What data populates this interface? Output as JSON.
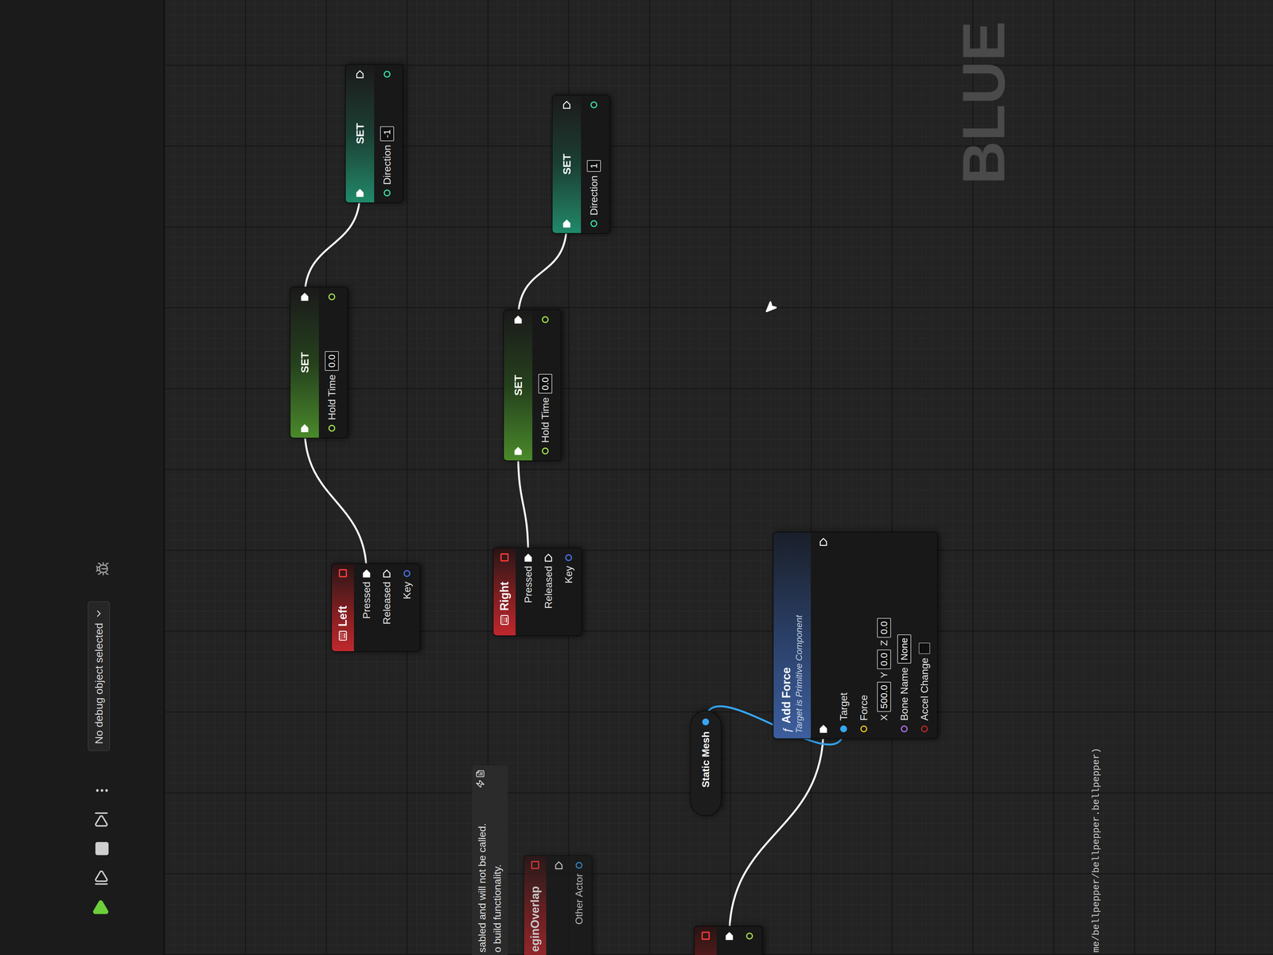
{
  "toolbar": {
    "debug_selector": "No debug object selected"
  },
  "canvas": {
    "watermark": "BLUE",
    "asset_path": "me/bellpepper/bellpepper.bellpepper)"
  },
  "disabled_notice": {
    "lines": [
      "sabled and will not be called.",
      "o build functionality."
    ]
  },
  "nodes": [
    {
      "kind": "event",
      "title": "eginOverlap",
      "disabled": true,
      "pins": [
        {
          "label": "",
          "type": "exec",
          "connected": false
        },
        {
          "label": "Other Actor",
          "type": "object",
          "connected": false
        }
      ]
    },
    {
      "kind": "event",
      "title": "Left",
      "disabled": false,
      "pins": [
        {
          "label": "Pressed",
          "type": "exec",
          "connected": true
        },
        {
          "label": "Released",
          "type": "exec",
          "connected": false
        },
        {
          "label": "Key",
          "type": "struct",
          "connected": false
        }
      ]
    },
    {
      "kind": "event",
      "title": "Right",
      "disabled": false,
      "pins": [
        {
          "label": "Pressed",
          "type": "exec",
          "connected": true
        },
        {
          "label": "Released",
          "type": "exec",
          "connected": false
        },
        {
          "label": "Key",
          "type": "struct",
          "connected": false
        }
      ]
    },
    {
      "kind": "set",
      "title": "SET",
      "exec_in_connected": true,
      "exec_out_connected": true,
      "variable": {
        "label": "Hold Time",
        "type": "float",
        "value": "0.0"
      }
    },
    {
      "kind": "set",
      "title": "SET",
      "exec_in_connected": true,
      "exec_out_connected": false,
      "variable": {
        "label": "Direction",
        "type": "int",
        "value": "-1"
      }
    },
    {
      "kind": "set",
      "title": "SET",
      "exec_in_connected": true,
      "exec_out_connected": true,
      "variable": {
        "label": "Hold Time",
        "type": "float",
        "value": "0.0"
      }
    },
    {
      "kind": "set",
      "title": "SET",
      "exec_in_connected": true,
      "exec_out_connected": false,
      "variable": {
        "label": "Direction",
        "type": "int",
        "value": "1"
      }
    },
    {
      "kind": "getter",
      "title": "Static Mesh",
      "out": {
        "type": "object",
        "connected": true
      }
    },
    {
      "kind": "function",
      "icon": "ƒ",
      "title": "Add Force",
      "subtitle": "Target is Primitive Component",
      "exec_in_connected": true,
      "exec_out_connected": false,
      "inputs": [
        {
          "label": "Target",
          "type": "object",
          "connected": true
        },
        {
          "label": "Force",
          "type": "vector",
          "connected": false,
          "fields": [
            {
              "axis": "X",
              "value": "500.0"
            },
            {
              "axis": "Y",
              "value": "0.0"
            },
            {
              "axis": "Z",
              "value": "0.0"
            }
          ]
        },
        {
          "label": "Bone Name",
          "type": "name",
          "connected": false,
          "value": "None"
        },
        {
          "label": "Accel Change",
          "type": "bool",
          "connected": false,
          "checked": false
        }
      ]
    },
    {
      "kind": "event",
      "disabled": false,
      "pins": [
        {
          "label": "",
          "type": "exec",
          "connected": true
        },
        {
          "label": "",
          "type": "float",
          "connected": false
        }
      ]
    }
  ],
  "links": [
    {
      "from": 1,
      "to": 3,
      "type": "exec"
    },
    {
      "from": 3,
      "to": 4,
      "type": "exec"
    },
    {
      "from": 2,
      "to": 5,
      "type": "exec"
    },
    {
      "from": 5,
      "to": 6,
      "type": "exec"
    },
    {
      "from": 9,
      "to": 8,
      "type": "exec"
    },
    {
      "from": 7,
      "to": 8,
      "type": "object"
    }
  ]
}
